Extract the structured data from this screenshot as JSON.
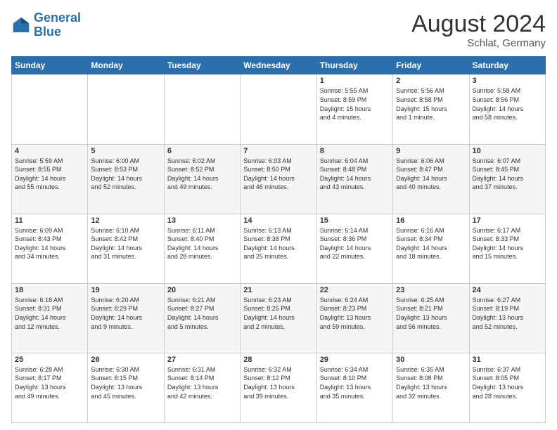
{
  "logo": {
    "text_general": "General",
    "text_blue": "Blue"
  },
  "header": {
    "month_year": "August 2024",
    "location": "Schlat, Germany"
  },
  "weekdays": [
    "Sunday",
    "Monday",
    "Tuesday",
    "Wednesday",
    "Thursday",
    "Friday",
    "Saturday"
  ],
  "weeks": [
    [
      {
        "day": "",
        "info": ""
      },
      {
        "day": "",
        "info": ""
      },
      {
        "day": "",
        "info": ""
      },
      {
        "day": "",
        "info": ""
      },
      {
        "day": "1",
        "info": "Sunrise: 5:55 AM\nSunset: 8:59 PM\nDaylight: 15 hours\nand 4 minutes."
      },
      {
        "day": "2",
        "info": "Sunrise: 5:56 AM\nSunset: 8:58 PM\nDaylight: 15 hours\nand 1 minute."
      },
      {
        "day": "3",
        "info": "Sunrise: 5:58 AM\nSunset: 8:56 PM\nDaylight: 14 hours\nand 58 minutes."
      }
    ],
    [
      {
        "day": "4",
        "info": "Sunrise: 5:59 AM\nSunset: 8:55 PM\nDaylight: 14 hours\nand 55 minutes."
      },
      {
        "day": "5",
        "info": "Sunrise: 6:00 AM\nSunset: 8:53 PM\nDaylight: 14 hours\nand 52 minutes."
      },
      {
        "day": "6",
        "info": "Sunrise: 6:02 AM\nSunset: 8:52 PM\nDaylight: 14 hours\nand 49 minutes."
      },
      {
        "day": "7",
        "info": "Sunrise: 6:03 AM\nSunset: 8:50 PM\nDaylight: 14 hours\nand 46 minutes."
      },
      {
        "day": "8",
        "info": "Sunrise: 6:04 AM\nSunset: 8:48 PM\nDaylight: 14 hours\nand 43 minutes."
      },
      {
        "day": "9",
        "info": "Sunrise: 6:06 AM\nSunset: 8:47 PM\nDaylight: 14 hours\nand 40 minutes."
      },
      {
        "day": "10",
        "info": "Sunrise: 6:07 AM\nSunset: 8:45 PM\nDaylight: 14 hours\nand 37 minutes."
      }
    ],
    [
      {
        "day": "11",
        "info": "Sunrise: 6:09 AM\nSunset: 8:43 PM\nDaylight: 14 hours\nand 34 minutes."
      },
      {
        "day": "12",
        "info": "Sunrise: 6:10 AM\nSunset: 8:42 PM\nDaylight: 14 hours\nand 31 minutes."
      },
      {
        "day": "13",
        "info": "Sunrise: 6:11 AM\nSunset: 8:40 PM\nDaylight: 14 hours\nand 28 minutes."
      },
      {
        "day": "14",
        "info": "Sunrise: 6:13 AM\nSunset: 8:38 PM\nDaylight: 14 hours\nand 25 minutes."
      },
      {
        "day": "15",
        "info": "Sunrise: 6:14 AM\nSunset: 8:36 PM\nDaylight: 14 hours\nand 22 minutes."
      },
      {
        "day": "16",
        "info": "Sunrise: 6:16 AM\nSunset: 8:34 PM\nDaylight: 14 hours\nand 18 minutes."
      },
      {
        "day": "17",
        "info": "Sunrise: 6:17 AM\nSunset: 8:33 PM\nDaylight: 14 hours\nand 15 minutes."
      }
    ],
    [
      {
        "day": "18",
        "info": "Sunrise: 6:18 AM\nSunset: 8:31 PM\nDaylight: 14 hours\nand 12 minutes."
      },
      {
        "day": "19",
        "info": "Sunrise: 6:20 AM\nSunset: 8:29 PM\nDaylight: 14 hours\nand 9 minutes."
      },
      {
        "day": "20",
        "info": "Sunrise: 6:21 AM\nSunset: 8:27 PM\nDaylight: 14 hours\nand 5 minutes."
      },
      {
        "day": "21",
        "info": "Sunrise: 6:23 AM\nSunset: 8:25 PM\nDaylight: 14 hours\nand 2 minutes."
      },
      {
        "day": "22",
        "info": "Sunrise: 6:24 AM\nSunset: 8:23 PM\nDaylight: 13 hours\nand 59 minutes."
      },
      {
        "day": "23",
        "info": "Sunrise: 6:25 AM\nSunset: 8:21 PM\nDaylight: 13 hours\nand 56 minutes."
      },
      {
        "day": "24",
        "info": "Sunrise: 6:27 AM\nSunset: 8:19 PM\nDaylight: 13 hours\nand 52 minutes."
      }
    ],
    [
      {
        "day": "25",
        "info": "Sunrise: 6:28 AM\nSunset: 8:17 PM\nDaylight: 13 hours\nand 49 minutes."
      },
      {
        "day": "26",
        "info": "Sunrise: 6:30 AM\nSunset: 8:15 PM\nDaylight: 13 hours\nand 45 minutes."
      },
      {
        "day": "27",
        "info": "Sunrise: 6:31 AM\nSunset: 8:14 PM\nDaylight: 13 hours\nand 42 minutes."
      },
      {
        "day": "28",
        "info": "Sunrise: 6:32 AM\nSunset: 8:12 PM\nDaylight: 13 hours\nand 39 minutes."
      },
      {
        "day": "29",
        "info": "Sunrise: 6:34 AM\nSunset: 8:10 PM\nDaylight: 13 hours\nand 35 minutes."
      },
      {
        "day": "30",
        "info": "Sunrise: 6:35 AM\nSunset: 8:08 PM\nDaylight: 13 hours\nand 32 minutes."
      },
      {
        "day": "31",
        "info": "Sunrise: 6:37 AM\nSunset: 8:05 PM\nDaylight: 13 hours\nand 28 minutes."
      }
    ]
  ]
}
